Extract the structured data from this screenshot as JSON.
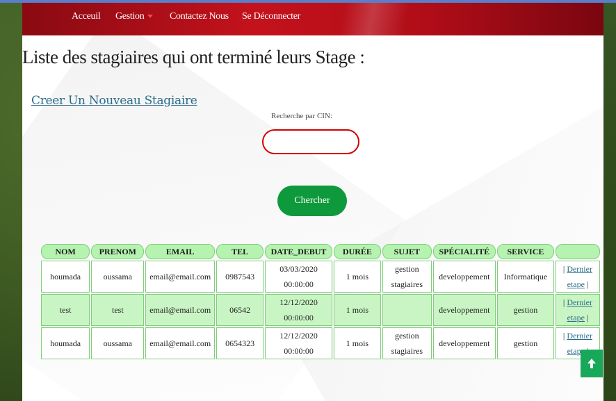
{
  "nav": {
    "items": [
      "Acceuil",
      "Gestion",
      "Contactez Nous",
      "Se Déconnecter"
    ]
  },
  "page": {
    "title": "Liste des stagiaires qui ont terminé leurs Stage :",
    "create_link": "Creer Un Nouveau Stagiaire",
    "search_label": "Recherche par CIN:",
    "search_value": "",
    "search_button": "Chercher"
  },
  "table": {
    "headers": [
      "NOM",
      "PRENOM",
      "EMAIL",
      "TEL",
      "DATE_DEBUT",
      "DURÉE",
      "SUJET",
      "SPÉCIALITÉ",
      "SERVICE",
      ""
    ],
    "rows": [
      {
        "nom": "houmada",
        "prenom": "oussama",
        "email": "email@email.com",
        "tel": "0987543",
        "date1": "03/03/2020",
        "date2": "00:00:00",
        "duree": "1 mois",
        "sujet1": "gestion",
        "sujet2": "stagiaires",
        "specialite": "developpement",
        "service": "Informatique",
        "pre": "| ",
        "link1": "Dernier",
        "link2": "etape",
        "post": " |"
      },
      {
        "nom": "test",
        "prenom": "test",
        "email": "email@email.com",
        "tel": "06542",
        "date1": "12/12/2020",
        "date2": "00:00:00",
        "duree": "1 mois",
        "sujet1": "",
        "sujet2": "",
        "specialite": "developpement",
        "service": "gestion",
        "pre": "| ",
        "link1": "Dernier",
        "link2": "etape",
        "post": " |"
      },
      {
        "nom": "houmada",
        "prenom": "oussama",
        "email": "email@email.com",
        "tel": "0654323",
        "date1": "12/12/2020",
        "date2": "00:00:00",
        "duree": "1 mois",
        "sujet1": "gestion",
        "sujet2": "stagiaires",
        "specialite": "developpement",
        "service": "gestion",
        "pre": "| ",
        "link1": "Dernier",
        "link2": "etape",
        "post": " |"
      }
    ]
  },
  "icons": {
    "scroll_top": "arrow-up-icon",
    "dropdown": "caret-down-icon"
  },
  "colors": {
    "navbar": "#c4121c",
    "button": "#0e9a3c",
    "table_header": "#b6f2b0",
    "row_alt": "#c9f5c4",
    "search_border": "#d00000",
    "link": "#2a6d8a"
  }
}
